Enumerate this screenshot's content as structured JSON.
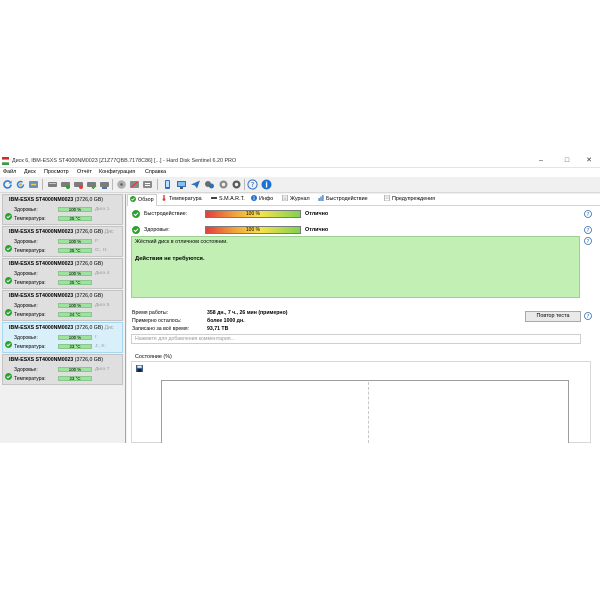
{
  "window": {
    "title": "Диск 6, IBM-ESXS ST4000NM0023 [Z1Z77QBB.7178C86]  [...]  -  Hard Disk Sentinel 6.20 PRO"
  },
  "menu": [
    "Файл",
    "Диск",
    "Просмотр",
    "Отчёт",
    "Конфигурация",
    "Справка"
  ],
  "disks": [
    {
      "model": "IBM-ESXS ST4000NM0023",
      "size": "(3726,0 GB)",
      "label": "",
      "health": "100 %",
      "temperature": "25 °C",
      "info1": "Диск 1",
      "info2": ""
    },
    {
      "model": "IBM-ESXS ST4000NM0023",
      "size": "(3726,0 GB)",
      "label": "Дис",
      "health": "100 %",
      "temperature": "25 °C",
      "info1": "F:",
      "info2": "G:, H:"
    },
    {
      "model": "IBM-ESXS ST4000NM0023",
      "size": "(3726,0 GB)",
      "label": "",
      "health": "100 %",
      "temperature": "25 °C",
      "info1": "Диск 4",
      "info2": ""
    },
    {
      "model": "IBM-ESXS ST4000NM0023",
      "size": "(3726,0 GB)",
      "label": "",
      "health": "100 %",
      "temperature": "24 °C",
      "info1": "Диск 5",
      "info2": ""
    },
    {
      "model": "IBM-ESXS ST4000NM0023",
      "size": "(3726,0 GB)",
      "label": "Дис",
      "health": "100 %",
      "temperature": "23 °C",
      "info1": "I:",
      "info2": "J:, K:"
    },
    {
      "model": "IBM-ESXS ST4000NM0023",
      "size": "(3726,0 GB)",
      "label": "",
      "health": "100 %",
      "temperature": "23 °C",
      "info1": "Диск 7",
      "info2": ""
    }
  ],
  "labels": {
    "health": "Здоровье:",
    "temperature": "Температура:"
  },
  "tabs": [
    "Обзор",
    "Температура",
    "S.M.A.R.T.",
    "Инфо",
    "Журнал",
    "Быстродействие",
    "Предупреждения"
  ],
  "overview": {
    "performance_label": "Быстродействие:",
    "performance_value": "100 %",
    "performance_fraction": 1.0,
    "performance_status": "Отлично",
    "health_label": "Здоровье:",
    "health_value": "100 %",
    "health_fraction": 1.0,
    "health_status": "Отлично",
    "status_text": "Жёсткий диск в отличном состоянии.",
    "action_text": "Действия не требуются.",
    "uptime_label": "Время работы:",
    "uptime_value": "358 дн., 7 ч., 26 мин (примерно)",
    "remaining_label": "Примерно осталось:",
    "remaining_value": "более 1000 дн.",
    "written_label": "Записано за всё время:",
    "written_value": "93,71 TB",
    "retest_button": "Повтор теста",
    "comment_placeholder": "Нажмите для добавления комментария...",
    "graph_title": "Состояние (%)"
  },
  "colors": {
    "ok_green": "#2fa02f",
    "bar_green": "#9de39d",
    "panel_green": "#c2f0b4",
    "selected_disk": "#d9f0fb",
    "info_blue": "#1e6fd0"
  }
}
